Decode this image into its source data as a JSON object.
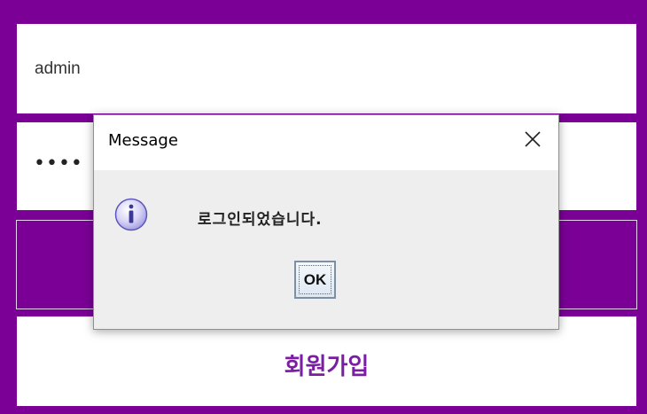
{
  "login_form": {
    "username_value": "admin",
    "password_value": "••••",
    "login_button_label": "",
    "signup_label": "회원가입"
  },
  "dialog": {
    "title": "Message",
    "message": "로그인되었습니다.",
    "ok_label": "OK",
    "icon": "information-icon"
  },
  "colors": {
    "background": "#7a0096",
    "field_background": "#ffffff",
    "signup_text": "#7b1fa2",
    "dialog_background": "#eeeeee"
  }
}
